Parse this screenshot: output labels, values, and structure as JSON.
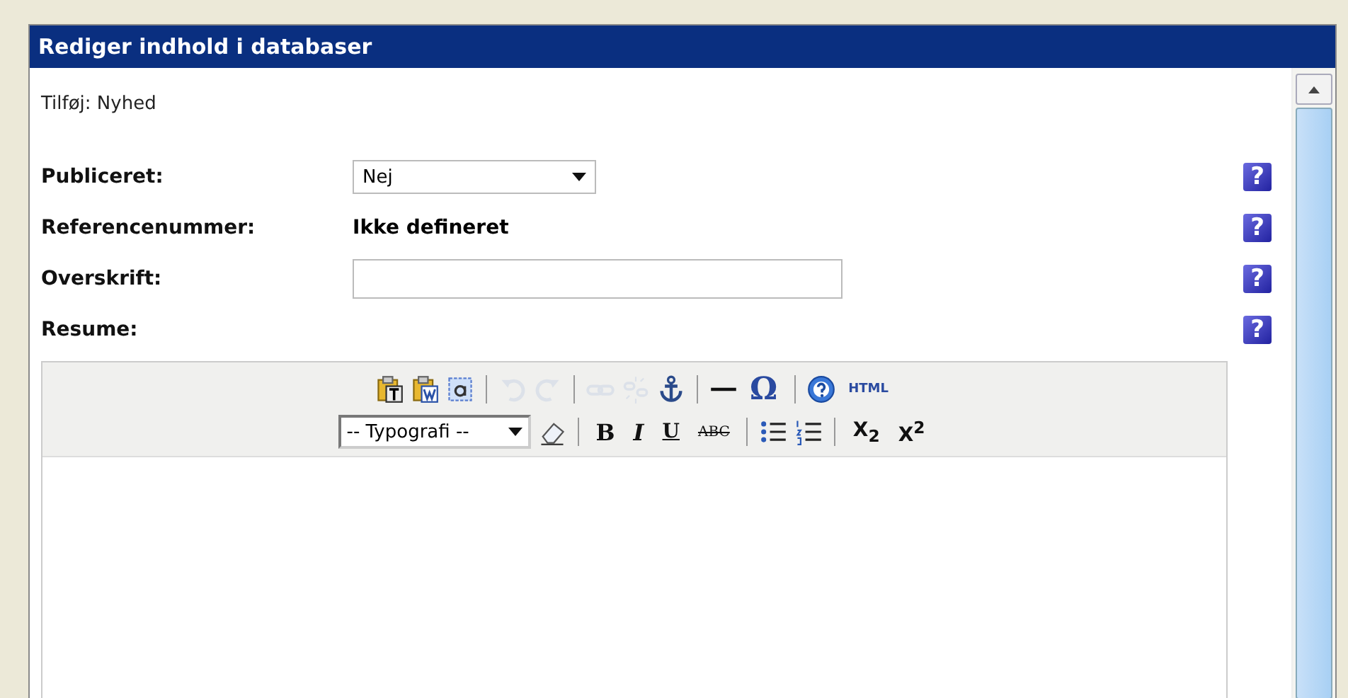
{
  "window": {
    "title": "Rediger indhold i databaser"
  },
  "subtitle": "Tilføj: Nyhed",
  "fields": [
    {
      "kind": "select",
      "label": "Publiceret:",
      "value": "Nej",
      "help": "?"
    },
    {
      "kind": "static",
      "label": "Referencenummer:",
      "value": "Ikke defineret",
      "help": "?"
    },
    {
      "kind": "input",
      "label": "Overskrift:",
      "help": "?"
    },
    {
      "kind": "editor",
      "label": "Resume:",
      "help": "?"
    }
  ],
  "toolbar": {
    "rows": [
      [
        {
          "kind": "icon",
          "disabled": false
        },
        {
          "kind": "icon",
          "disabled": false
        },
        {
          "kind": "icon",
          "disabled": false
        },
        {
          "kind": "separator"
        },
        {
          "kind": "icon",
          "disabled": true
        },
        {
          "kind": "icon",
          "disabled": true
        },
        {
          "kind": "separator"
        },
        {
          "kind": "icon",
          "disabled": true
        },
        {
          "kind": "icon",
          "disabled": true
        },
        {
          "kind": "icon",
          "disabled": false
        },
        {
          "kind": "separator"
        },
        {
          "kind": "icon",
          "disabled": false
        },
        {
          "kind": "text",
          "text": "Ω"
        },
        {
          "kind": "separator"
        },
        {
          "kind": "icon",
          "disabled": false
        },
        {
          "kind": "text",
          "text": "HTML"
        }
      ],
      [
        {
          "kind": "select",
          "text": "-- Typografi --"
        },
        {
          "kind": "icon",
          "disabled": false
        },
        {
          "kind": "separator"
        },
        {
          "kind": "text",
          "text": "B"
        },
        {
          "kind": "text",
          "text": "I"
        },
        {
          "kind": "text",
          "text": "U"
        },
        {
          "kind": "text",
          "text": "ABC"
        },
        {
          "kind": "separator"
        },
        {
          "kind": "icon",
          "disabled": false
        },
        {
          "kind": "icon",
          "disabled": false
        },
        {
          "kind": "separator"
        },
        {
          "kind": "text",
          "text": "X$_{2}$"
        },
        {
          "kind": "text",
          "text": "X$^{2}$"
        }
      ]
    ]
  }
}
